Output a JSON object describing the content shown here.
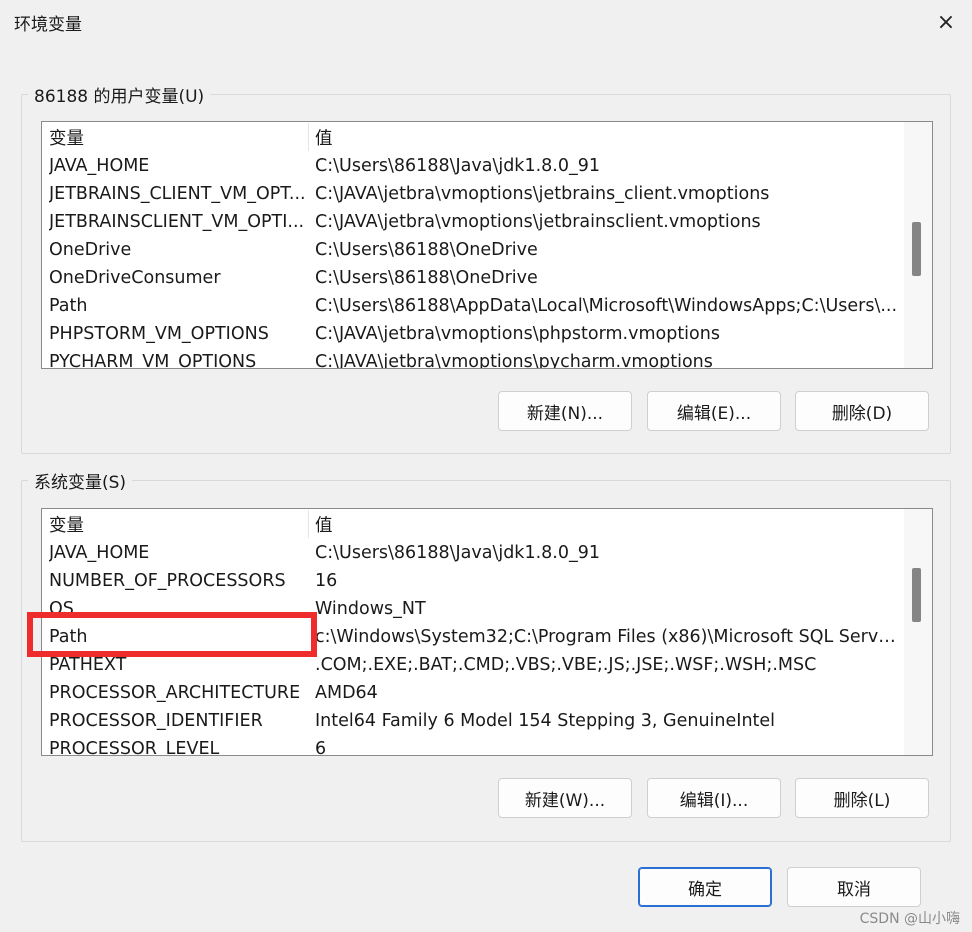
{
  "window": {
    "title": "环境变量",
    "close_icon": "×"
  },
  "user_vars": {
    "legend": "86188 的用户变量(U)",
    "columns": [
      "变量",
      "值"
    ],
    "rows": [
      {
        "name": "JAVA_HOME",
        "value": "C:\\Users\\86188\\Java\\jdk1.8.0_91"
      },
      {
        "name": "JETBRAINS_CLIENT_VM_OPT...",
        "value": "C:\\JAVA\\jetbra\\vmoptions\\jetbrains_client.vmoptions"
      },
      {
        "name": "JETBRAINSCLIENT_VM_OPTI...",
        "value": "C:\\JAVA\\jetbra\\vmoptions\\jetbrainsclient.vmoptions"
      },
      {
        "name": "OneDrive",
        "value": "C:\\Users\\86188\\OneDrive"
      },
      {
        "name": "OneDriveConsumer",
        "value": "C:\\Users\\86188\\OneDrive"
      },
      {
        "name": "Path",
        "value": "C:\\Users\\86188\\AppData\\Local\\Microsoft\\WindowsApps;C:\\Users\\..."
      },
      {
        "name": "PHPSTORM_VM_OPTIONS",
        "value": "C:\\JAVA\\jetbra\\vmoptions\\phpstorm.vmoptions"
      },
      {
        "name": "PYCHARM_VM_OPTIONS",
        "value": "C:\\JAVA\\jetbra\\vmoptions\\pycharm.vmoptions"
      }
    ],
    "buttons": {
      "new": "新建(N)...",
      "edit": "编辑(E)...",
      "delete": "删除(D)"
    }
  },
  "system_vars": {
    "legend": "系统变量(S)",
    "columns": [
      "变量",
      "值"
    ],
    "rows": [
      {
        "name": "JAVA_HOME",
        "value": "C:\\Users\\86188\\Java\\jdk1.8.0_91"
      },
      {
        "name": "NUMBER_OF_PROCESSORS",
        "value": "16"
      },
      {
        "name": "OS",
        "value": "Windows_NT"
      },
      {
        "name": "Path",
        "value": "c:\\Windows\\System32;C:\\Program Files (x86)\\Microsoft SQL Server..."
      },
      {
        "name": "PATHEXT",
        "value": ".COM;.EXE;.BAT;.CMD;.VBS;.VBE;.JS;.JSE;.WSF;.WSH;.MSC"
      },
      {
        "name": "PROCESSOR_ARCHITECTURE",
        "value": "AMD64"
      },
      {
        "name": "PROCESSOR_IDENTIFIER",
        "value": "Intel64 Family 6 Model 154 Stepping 3, GenuineIntel"
      },
      {
        "name": "PROCESSOR_LEVEL",
        "value": "6"
      }
    ],
    "buttons": {
      "new": "新建(W)...",
      "edit": "编辑(I)...",
      "delete": "删除(L)"
    }
  },
  "footer": {
    "ok": "确定",
    "cancel": "取消"
  },
  "watermark": "CSDN @山小嗨",
  "colors": {
    "highlight": "#ee2c2c",
    "primary_border": "#2a6fd4"
  }
}
